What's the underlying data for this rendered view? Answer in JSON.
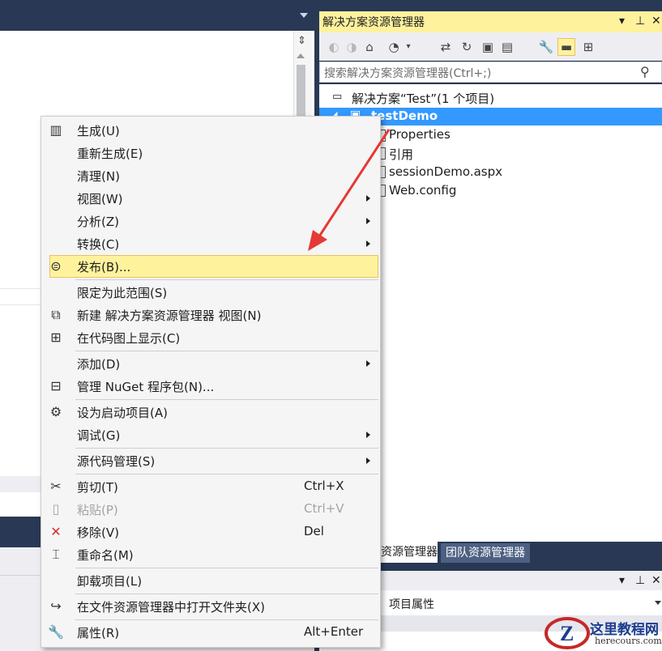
{
  "solution_explorer": {
    "title": "解决方案资源管理器",
    "search_placeholder": "搜索解决方案资源管理器(Ctrl+;)",
    "solution_label": "解决方案“Test”(1 个项目)",
    "project_label": "testDemo",
    "items": [
      "Properties",
      "引用",
      "sessionDemo.aspx",
      "Web.config"
    ]
  },
  "bottom_tabs": {
    "solution_explorer_tab": "解决方案资源管理器",
    "team_explorer_tab": "团队资源管理器"
  },
  "properties": {
    "title": "项目属性"
  },
  "context_menu": {
    "items": [
      {
        "label": "生成(U)",
        "icon": "build-icon"
      },
      {
        "label": "重新生成(E)"
      },
      {
        "label": "清理(N)"
      },
      {
        "label": "视图(W)",
        "submenu": true
      },
      {
        "label": "分析(Z)",
        "submenu": true
      },
      {
        "label": "转换(C)",
        "submenu": true
      },
      {
        "label": "发布(B)...",
        "icon": "publish-icon",
        "highlighted": true
      },
      {
        "label": "限定为此范围(S)"
      },
      {
        "label": "新建 解决方案资源管理器 视图(N)",
        "icon": "new-view-icon"
      },
      {
        "label": "在代码图上显示(C)",
        "icon": "code-map-icon"
      },
      {
        "label": "添加(D)",
        "submenu": true
      },
      {
        "label": "管理 NuGet 程序包(N)...",
        "icon": "nuget-icon"
      },
      {
        "label": "设为启动项目(A)",
        "icon": "gear-icon"
      },
      {
        "label": "调试(G)",
        "submenu": true
      },
      {
        "label": "源代码管理(S)",
        "submenu": true
      },
      {
        "label": "剪切(T)",
        "shortcut": "Ctrl+X",
        "icon": "scissors-icon"
      },
      {
        "label": "粘贴(P)",
        "shortcut": "Ctrl+V",
        "icon": "paste-icon",
        "disabled": true
      },
      {
        "label": "移除(V)",
        "shortcut": "Del",
        "icon": "remove-icon"
      },
      {
        "label": "重命名(M)",
        "icon": "rename-icon"
      },
      {
        "label": "卸载项目(L)"
      },
      {
        "label": "在文件资源管理器中打开文件夹(X)",
        "icon": "open-folder-icon"
      },
      {
        "label": "属性(R)",
        "shortcut": "Alt+Enter",
        "icon": "wrench-icon"
      }
    ]
  },
  "watermark": {
    "title": "这里教程网",
    "url": "herecours.com"
  },
  "colors": {
    "highlight": "#fff29d",
    "selection": "#3399ff",
    "annotation_arrow": "#e53935",
    "chrome": "#293955"
  }
}
